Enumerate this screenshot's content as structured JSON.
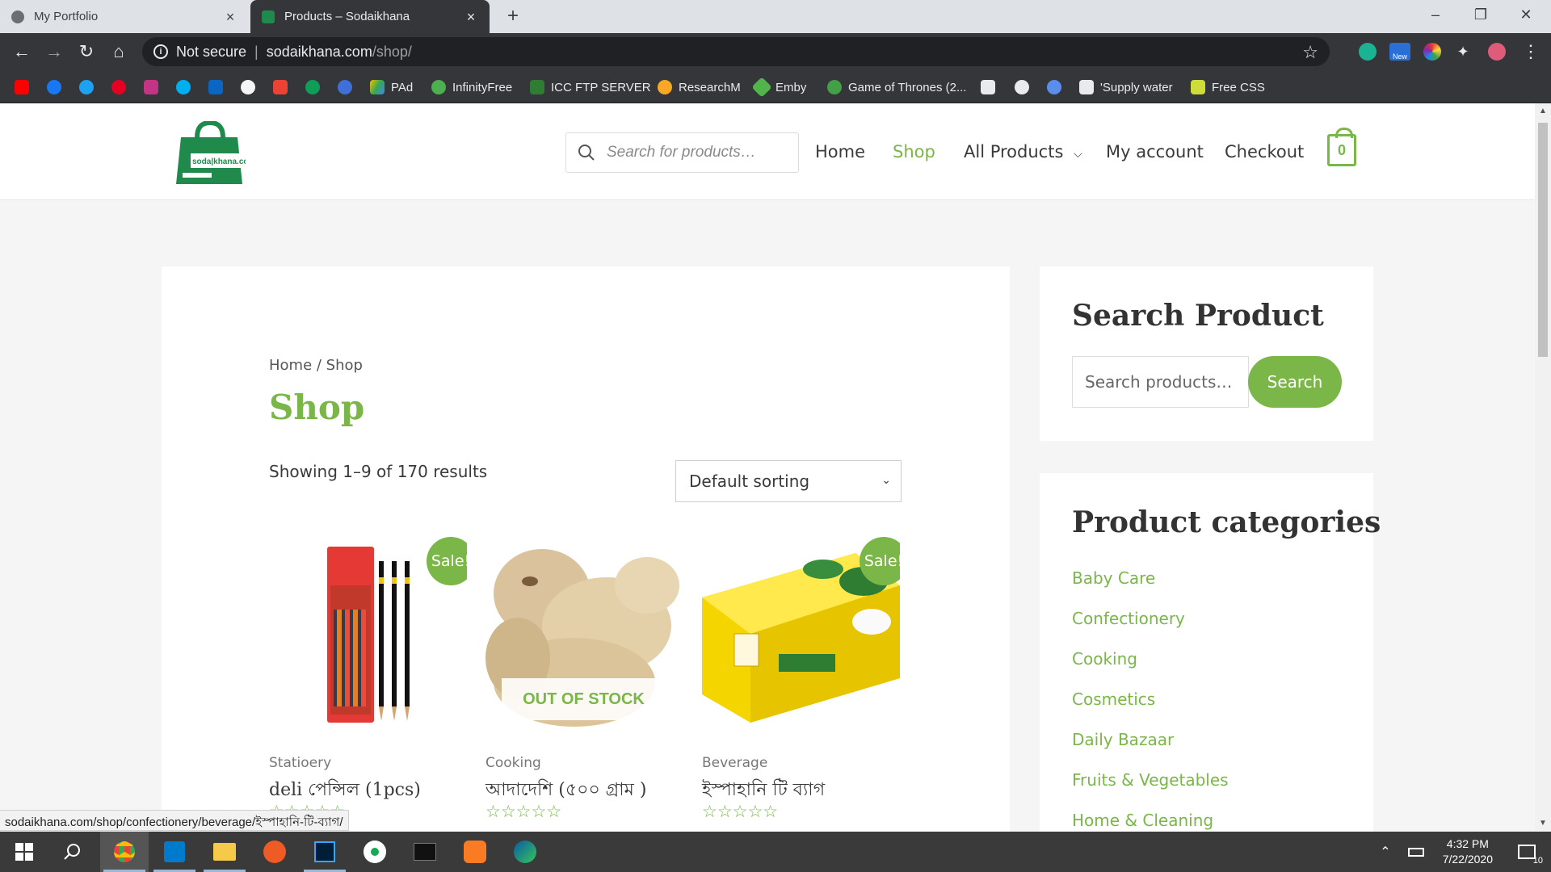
{
  "browser": {
    "tabs": [
      {
        "title": "My Portfolio",
        "active": false
      },
      {
        "title": "Products – Sodaikhana",
        "active": true
      }
    ],
    "new_tab": "+",
    "security_label": "Not secure",
    "url_host": "sodaikhana.com",
    "url_path": "/shop/",
    "bookmarks": [
      "PAd",
      "InfinityFree",
      "ICC FTP SERVER",
      "ResearchM",
      "Emby",
      "Game of Thrones (2...",
      "'Supply water",
      "Free CSS"
    ],
    "extension_badge": "New"
  },
  "header": {
    "logo_text": "soda|khana.com",
    "search_placeholder": "Search for products…",
    "menu": [
      "Home",
      "Shop",
      "All Products",
      "My account",
      "Checkout"
    ],
    "active_menu": "Shop",
    "cart_count": "0"
  },
  "main": {
    "breadcrumb": "Home / Shop",
    "title": "Shop",
    "results": "Showing 1–9 of 170 results",
    "sort": "Default sorting",
    "products": [
      {
        "category": "Statioery",
        "name": "deli পেন্সিল (1pcs)",
        "sale": "Sale!",
        "rating": "☆☆☆☆☆"
      },
      {
        "category": "Cooking",
        "name": "আদাদেশি (৫০০ গ্রাম )",
        "badge": "OUT OF STOCK",
        "rating": "☆☆☆☆☆"
      },
      {
        "category": "Beverage",
        "name": "ইস্পাহানি টি ব্যাগ",
        "sale": "Sale!",
        "rating": "☆☆☆☆☆"
      }
    ]
  },
  "sidebar": {
    "search_title": "Search Product",
    "search_placeholder": "Search products…",
    "search_button": "Search",
    "categories_title": "Product categories",
    "categories": [
      "Baby Care",
      "Confectionery",
      "Cooking",
      "Cosmetics",
      "Daily Bazaar",
      "Fruits & Vegetables",
      "Home & Cleaning"
    ]
  },
  "status_url": "sodaikhana.com/shop/confectionery/beverage/ইস্পাহানি-টি-ব্যাগ/",
  "taskbar": {
    "time": "4:32 PM",
    "date": "7/22/2020",
    "notification_count": "10"
  },
  "colors": {
    "brand_green": "#7ab648",
    "chrome_dark": "#35363a"
  }
}
